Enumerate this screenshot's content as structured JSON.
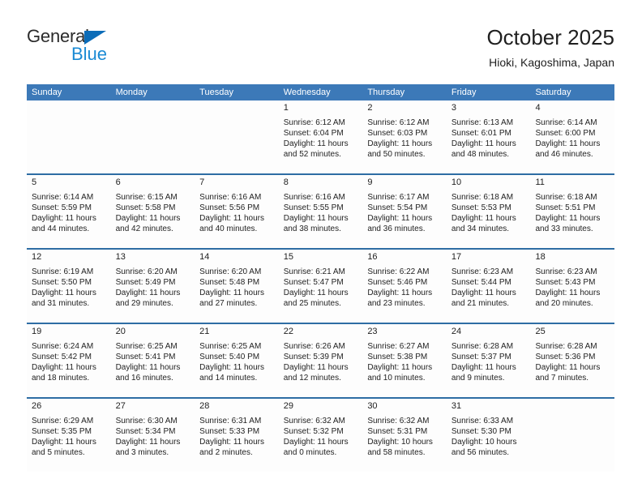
{
  "brand": {
    "name_part1": "General",
    "name_part2": "Blue",
    "triangle_color": "#0b6cb8",
    "blue_color": "#1a8ad4"
  },
  "header": {
    "title": "October 2025",
    "subtitle": "Hioki, Kagoshima, Japan"
  },
  "theme": {
    "header_blue": "#3c79b8",
    "divider_blue": "#2e6da4",
    "daynum_band": "#efeff0",
    "text": "#222222"
  },
  "calendar": {
    "weekday_headers": [
      "Sunday",
      "Monday",
      "Tuesday",
      "Wednesday",
      "Thursday",
      "Friday",
      "Saturday"
    ],
    "weeks": [
      [
        {
          "day": "",
          "lines": []
        },
        {
          "day": "",
          "lines": []
        },
        {
          "day": "",
          "lines": []
        },
        {
          "day": "1",
          "lines": [
            "Sunrise: 6:12 AM",
            "Sunset: 6:04 PM",
            "Daylight: 11 hours",
            "and 52 minutes."
          ]
        },
        {
          "day": "2",
          "lines": [
            "Sunrise: 6:12 AM",
            "Sunset: 6:03 PM",
            "Daylight: 11 hours",
            "and 50 minutes."
          ]
        },
        {
          "day": "3",
          "lines": [
            "Sunrise: 6:13 AM",
            "Sunset: 6:01 PM",
            "Daylight: 11 hours",
            "and 48 minutes."
          ]
        },
        {
          "day": "4",
          "lines": [
            "Sunrise: 6:14 AM",
            "Sunset: 6:00 PM",
            "Daylight: 11 hours",
            "and 46 minutes."
          ]
        }
      ],
      [
        {
          "day": "5",
          "lines": [
            "Sunrise: 6:14 AM",
            "Sunset: 5:59 PM",
            "Daylight: 11 hours",
            "and 44 minutes."
          ]
        },
        {
          "day": "6",
          "lines": [
            "Sunrise: 6:15 AM",
            "Sunset: 5:58 PM",
            "Daylight: 11 hours",
            "and 42 minutes."
          ]
        },
        {
          "day": "7",
          "lines": [
            "Sunrise: 6:16 AM",
            "Sunset: 5:56 PM",
            "Daylight: 11 hours",
            "and 40 minutes."
          ]
        },
        {
          "day": "8",
          "lines": [
            "Sunrise: 6:16 AM",
            "Sunset: 5:55 PM",
            "Daylight: 11 hours",
            "and 38 minutes."
          ]
        },
        {
          "day": "9",
          "lines": [
            "Sunrise: 6:17 AM",
            "Sunset: 5:54 PM",
            "Daylight: 11 hours",
            "and 36 minutes."
          ]
        },
        {
          "day": "10",
          "lines": [
            "Sunrise: 6:18 AM",
            "Sunset: 5:53 PM",
            "Daylight: 11 hours",
            "and 34 minutes."
          ]
        },
        {
          "day": "11",
          "lines": [
            "Sunrise: 6:18 AM",
            "Sunset: 5:51 PM",
            "Daylight: 11 hours",
            "and 33 minutes."
          ]
        }
      ],
      [
        {
          "day": "12",
          "lines": [
            "Sunrise: 6:19 AM",
            "Sunset: 5:50 PM",
            "Daylight: 11 hours",
            "and 31 minutes."
          ]
        },
        {
          "day": "13",
          "lines": [
            "Sunrise: 6:20 AM",
            "Sunset: 5:49 PM",
            "Daylight: 11 hours",
            "and 29 minutes."
          ]
        },
        {
          "day": "14",
          "lines": [
            "Sunrise: 6:20 AM",
            "Sunset: 5:48 PM",
            "Daylight: 11 hours",
            "and 27 minutes."
          ]
        },
        {
          "day": "15",
          "lines": [
            "Sunrise: 6:21 AM",
            "Sunset: 5:47 PM",
            "Daylight: 11 hours",
            "and 25 minutes."
          ]
        },
        {
          "day": "16",
          "lines": [
            "Sunrise: 6:22 AM",
            "Sunset: 5:46 PM",
            "Daylight: 11 hours",
            "and 23 minutes."
          ]
        },
        {
          "day": "17",
          "lines": [
            "Sunrise: 6:23 AM",
            "Sunset: 5:44 PM",
            "Daylight: 11 hours",
            "and 21 minutes."
          ]
        },
        {
          "day": "18",
          "lines": [
            "Sunrise: 6:23 AM",
            "Sunset: 5:43 PM",
            "Daylight: 11 hours",
            "and 20 minutes."
          ]
        }
      ],
      [
        {
          "day": "19",
          "lines": [
            "Sunrise: 6:24 AM",
            "Sunset: 5:42 PM",
            "Daylight: 11 hours",
            "and 18 minutes."
          ]
        },
        {
          "day": "20",
          "lines": [
            "Sunrise: 6:25 AM",
            "Sunset: 5:41 PM",
            "Daylight: 11 hours",
            "and 16 minutes."
          ]
        },
        {
          "day": "21",
          "lines": [
            "Sunrise: 6:25 AM",
            "Sunset: 5:40 PM",
            "Daylight: 11 hours",
            "and 14 minutes."
          ]
        },
        {
          "day": "22",
          "lines": [
            "Sunrise: 6:26 AM",
            "Sunset: 5:39 PM",
            "Daylight: 11 hours",
            "and 12 minutes."
          ]
        },
        {
          "day": "23",
          "lines": [
            "Sunrise: 6:27 AM",
            "Sunset: 5:38 PM",
            "Daylight: 11 hours",
            "and 10 minutes."
          ]
        },
        {
          "day": "24",
          "lines": [
            "Sunrise: 6:28 AM",
            "Sunset: 5:37 PM",
            "Daylight: 11 hours",
            "and 9 minutes."
          ]
        },
        {
          "day": "25",
          "lines": [
            "Sunrise: 6:28 AM",
            "Sunset: 5:36 PM",
            "Daylight: 11 hours",
            "and 7 minutes."
          ]
        }
      ],
      [
        {
          "day": "26",
          "lines": [
            "Sunrise: 6:29 AM",
            "Sunset: 5:35 PM",
            "Daylight: 11 hours",
            "and 5 minutes."
          ]
        },
        {
          "day": "27",
          "lines": [
            "Sunrise: 6:30 AM",
            "Sunset: 5:34 PM",
            "Daylight: 11 hours",
            "and 3 minutes."
          ]
        },
        {
          "day": "28",
          "lines": [
            "Sunrise: 6:31 AM",
            "Sunset: 5:33 PM",
            "Daylight: 11 hours",
            "and 2 minutes."
          ]
        },
        {
          "day": "29",
          "lines": [
            "Sunrise: 6:32 AM",
            "Sunset: 5:32 PM",
            "Daylight: 11 hours",
            "and 0 minutes."
          ]
        },
        {
          "day": "30",
          "lines": [
            "Sunrise: 6:32 AM",
            "Sunset: 5:31 PM",
            "Daylight: 10 hours",
            "and 58 minutes."
          ]
        },
        {
          "day": "31",
          "lines": [
            "Sunrise: 6:33 AM",
            "Sunset: 5:30 PM",
            "Daylight: 10 hours",
            "and 56 minutes."
          ]
        },
        {
          "day": "",
          "lines": []
        }
      ]
    ]
  }
}
